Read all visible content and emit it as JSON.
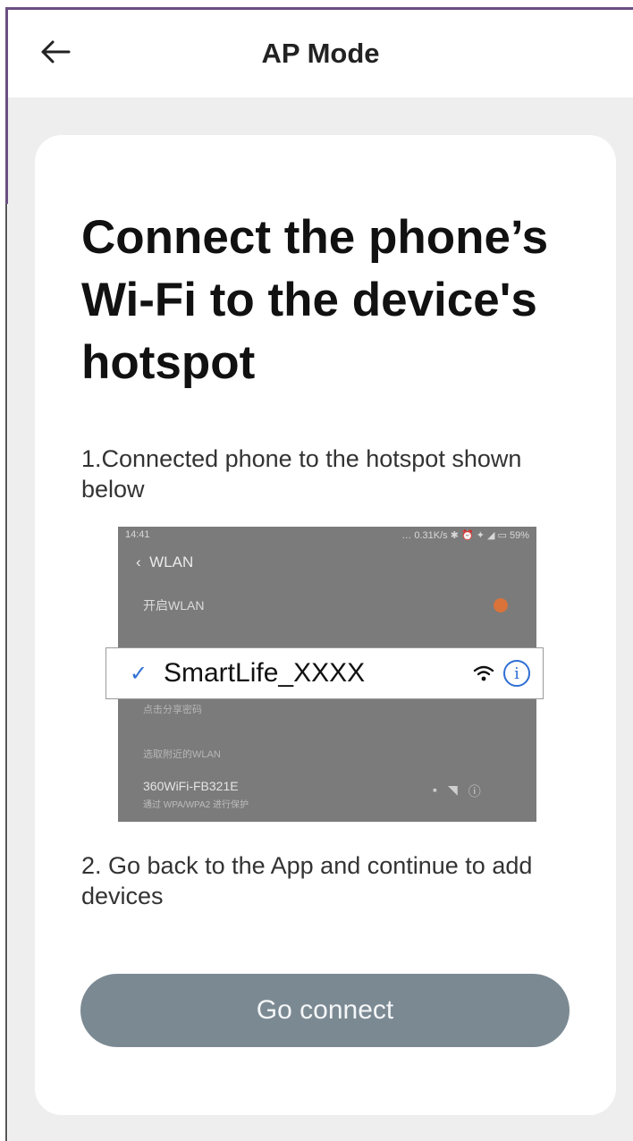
{
  "nav": {
    "back_icon": "arrow-left-icon",
    "title": "AP Mode"
  },
  "card": {
    "heading": "Connect the phone’s Wi-Fi to the device's hotspot",
    "step1": "1.Connected phone to the hotspot shown below",
    "step2": "2. Go back to the App and continue to add devices"
  },
  "illustration": {
    "status_time": "14:41",
    "status_right": "… 0.31K/s ✱ ⏰ ✦ ◢ ▭ 59%",
    "header": "WLAN",
    "toggle_row": "开启WLAN",
    "hotspot_ssid": "SmartLife_XXXX",
    "check_icon": "checkmark-icon",
    "wifi_icon": "wifi-icon",
    "info_icon": "info-icon",
    "share_row": "点击分享密码",
    "choose_row": "选取附近的WLAN",
    "other_network": "360WiFi-FB321E",
    "other_network_sub": "通过 WPA/WPA2 进行保护",
    "accent_color": "#2f6fd4"
  },
  "button": {
    "label": "Go connect",
    "color": "#7b8993"
  }
}
